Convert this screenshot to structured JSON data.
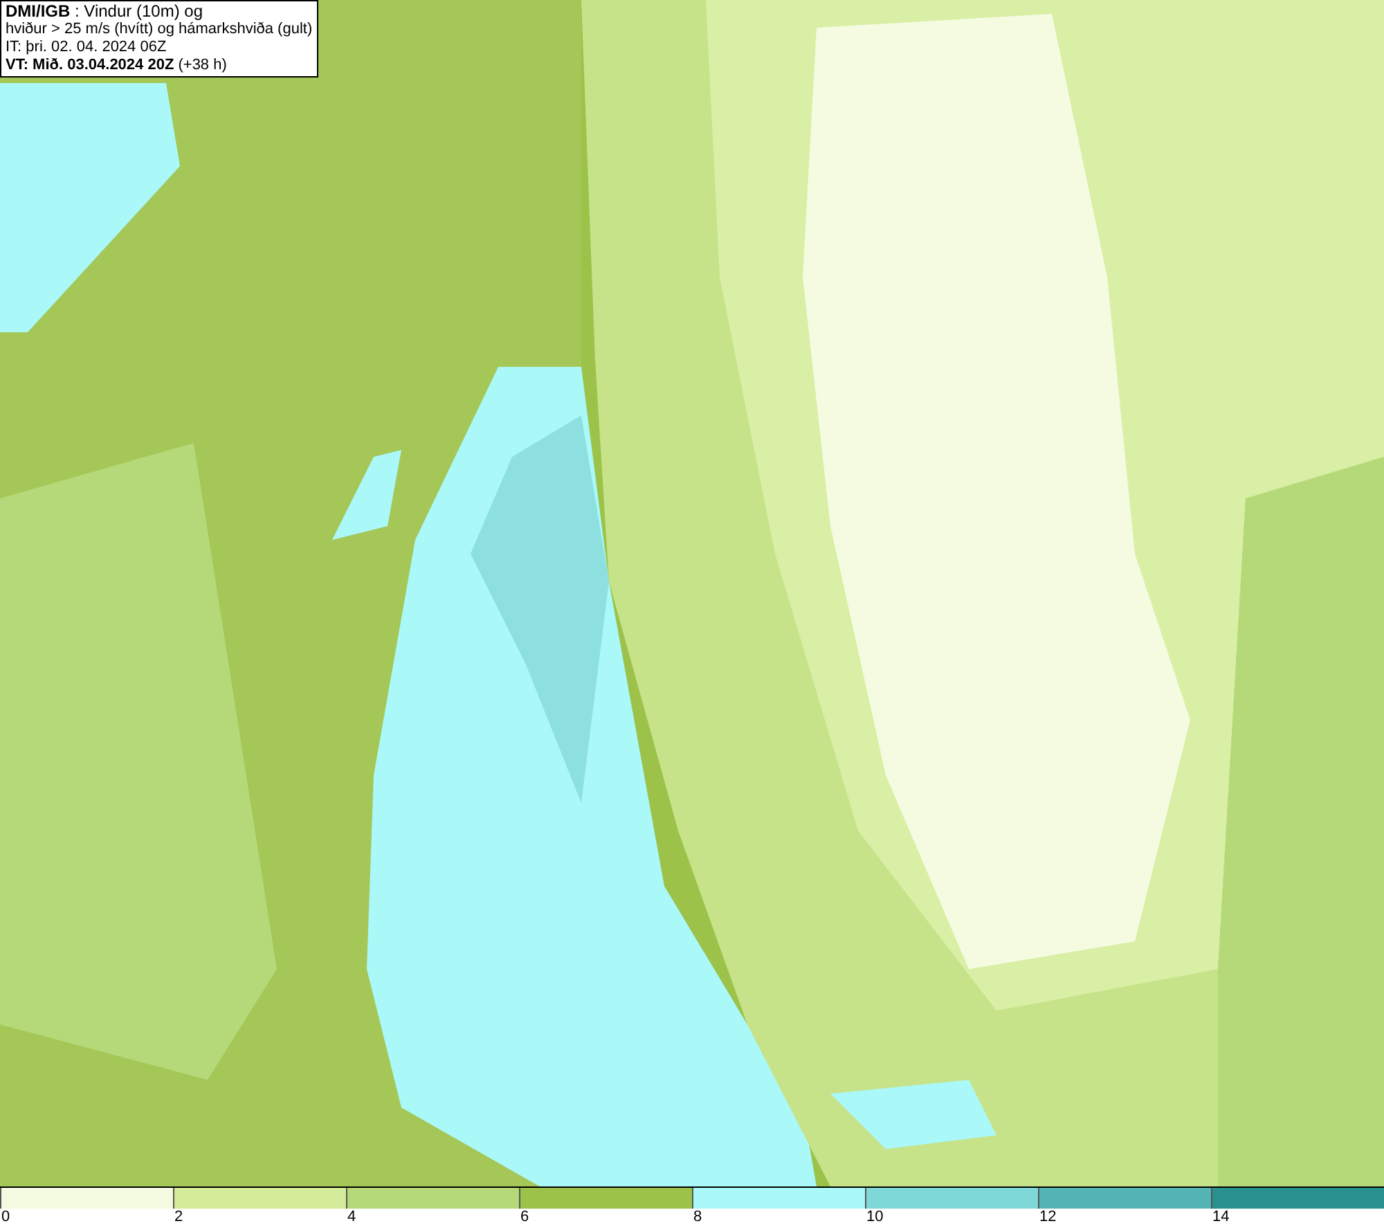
{
  "info_box": {
    "lines": [
      "**DMI/IGB** : Vindur (10m) og",
      "hviður > 25 m/s (hvítt) og hámarkshviða (gult)",
      "IT: þri. 02. 04. 2024 06Z",
      "**VT: Mið. 03.04.2024 20Z** (+38 h)"
    ]
  },
  "legend": [
    {
      "label": "0",
      "color": "#f5fbe0"
    },
    {
      "label": "2",
      "color": "#d4ec9a"
    },
    {
      "label": "4",
      "color": "#b5d978"
    },
    {
      "label": "6",
      "color": "#9cc24a"
    },
    {
      "label": "8",
      "color": "#aaf8f8"
    },
    {
      "label": "10",
      "color": "#7fd8d8"
    },
    {
      "label": "12",
      "color": "#55b4b4"
    },
    {
      "label": "14",
      "color": "#2a9090"
    }
  ]
}
